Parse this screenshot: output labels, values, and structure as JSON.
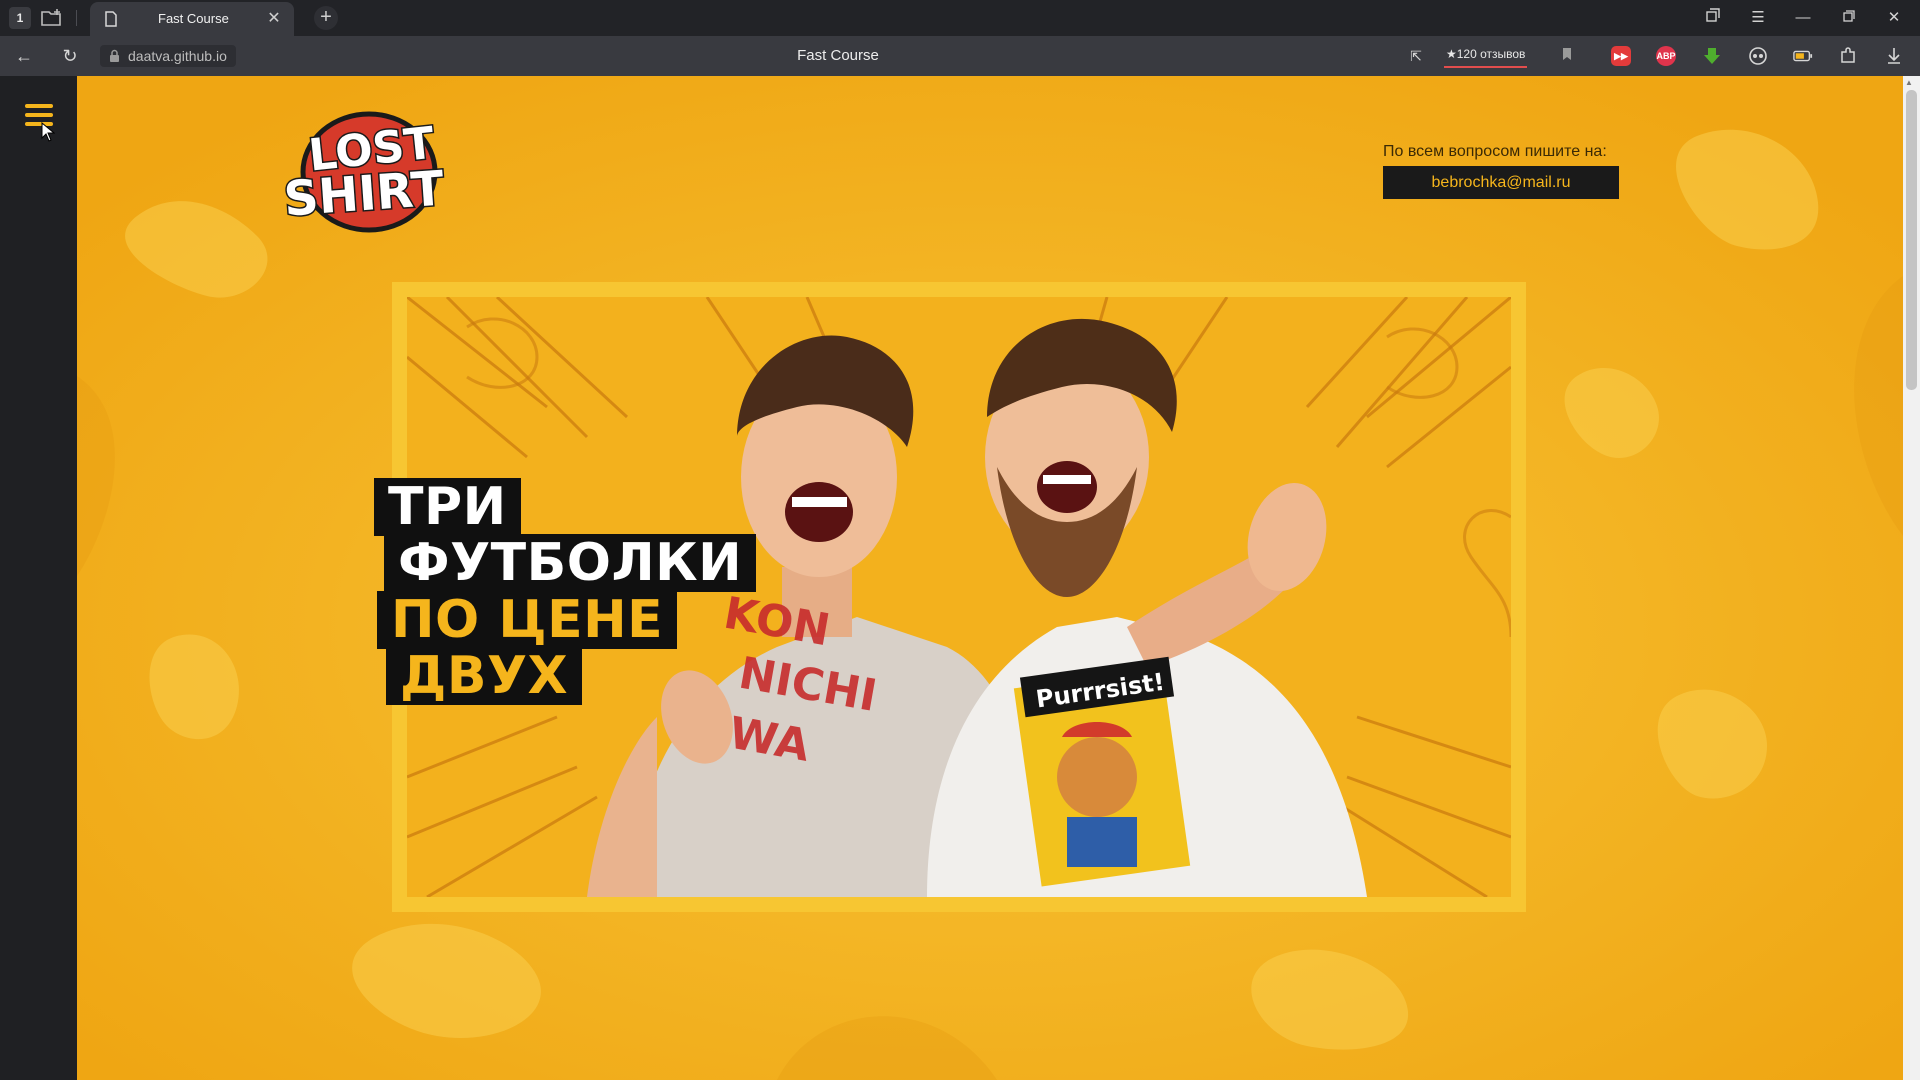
{
  "browser": {
    "tab_count": "1",
    "tab": {
      "title": "Fast Course"
    },
    "address": {
      "url": "daatva.github.io"
    },
    "page_title": "Fast Course",
    "reviews": "★120 отзывов",
    "extensions": [
      {
        "name": "youtube-ext-icon",
        "label": "▶▶",
        "color": "#e33b3b"
      },
      {
        "name": "adblock-icon",
        "label": "ABP",
        "color": "#e0344c"
      },
      {
        "name": "download-helper-icon",
        "label": "",
        "color": "#4fae2e"
      }
    ]
  },
  "site": {
    "contact_label": "По всем вопросом пишите на:",
    "contact_email": "bebrochka@mail.ru",
    "logo": {
      "line1": "LOST",
      "line2": "SHIRT"
    },
    "headline": {
      "line1": "ТРИ",
      "line2": "ФУТБОЛКИ",
      "line3": "ПО ЦЕНЕ",
      "line4": "ДВУХ"
    },
    "shirt_text_left": "KONNICHIWA",
    "shirt_text_right": "Purrrsist!"
  },
  "colors": {
    "accent": "#f5b51c",
    "page_bg": "#f4b21a",
    "sidebar_bg": "#1f2023",
    "dark": "#101010"
  }
}
